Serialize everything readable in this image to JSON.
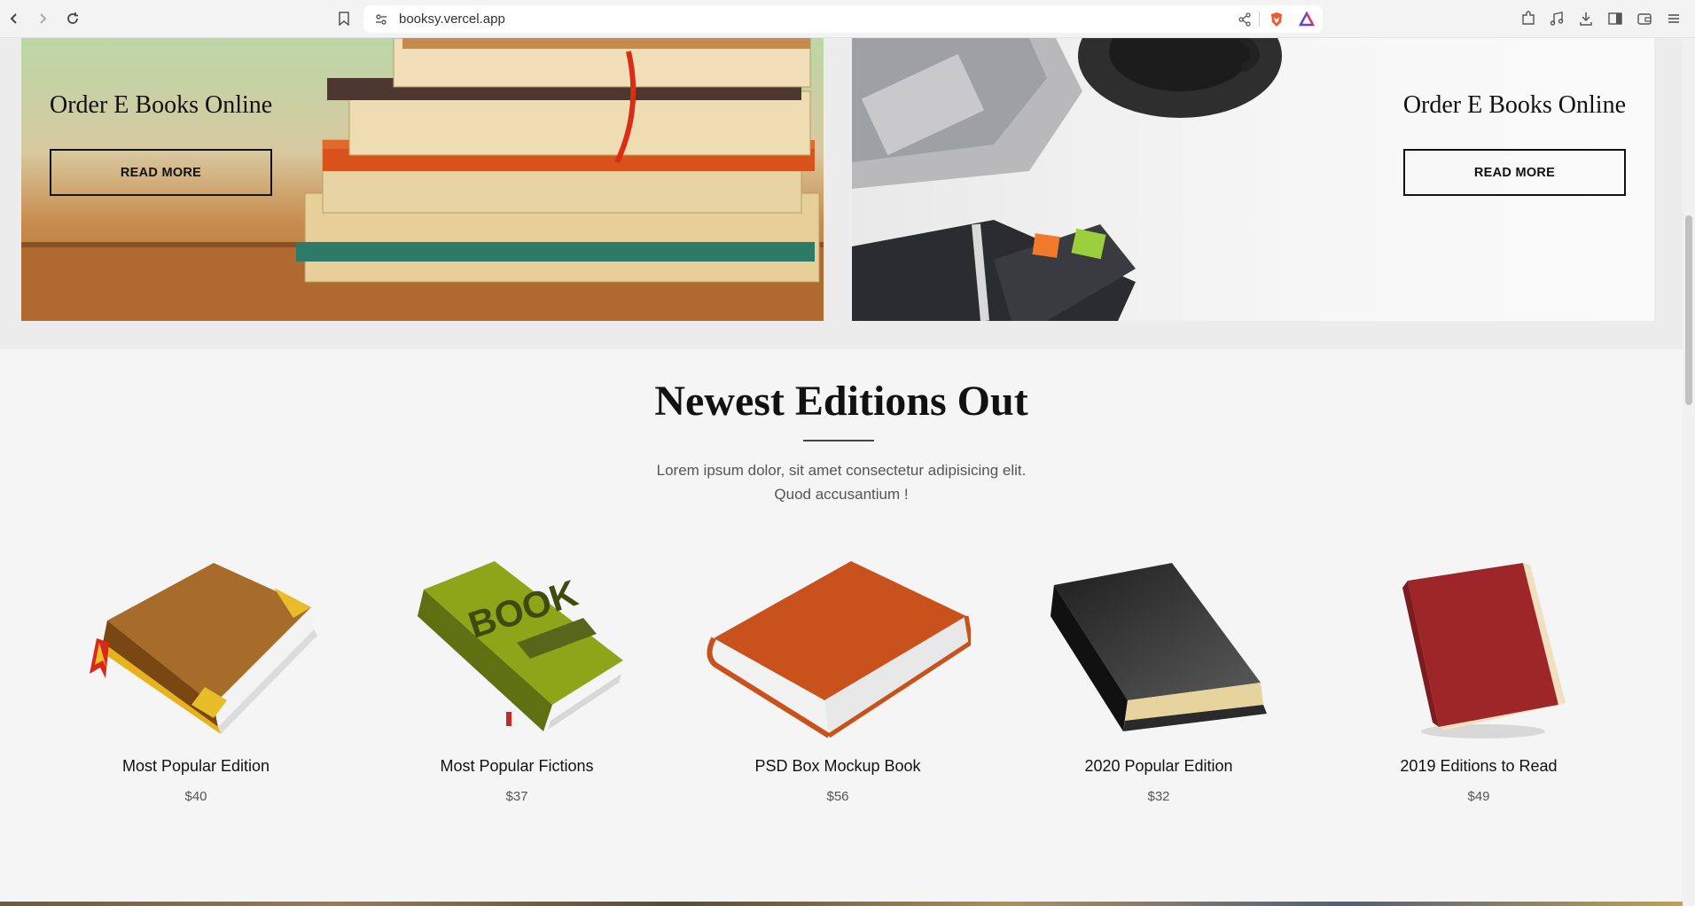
{
  "browser": {
    "url": "booksy.vercel.app"
  },
  "banners": [
    {
      "title": "Order E Books Online",
      "button": "READ MORE"
    },
    {
      "title": "Order E Books Online",
      "button": "READ MORE"
    }
  ],
  "section": {
    "title": "Newest Editions Out",
    "subtitle_line1": "Lorem ipsum dolor, sit amet consectetur adipisicing elit.",
    "subtitle_line2": "Quod accusantium !"
  },
  "products": [
    {
      "name": "Most Popular Edition",
      "price": "$40",
      "icon": "brown-book-icon"
    },
    {
      "name": "Most Popular Fictions",
      "price": "$37",
      "icon": "green-book-icon"
    },
    {
      "name": "PSD Box Mockup Book",
      "price": "$56",
      "icon": "orange-book-icon"
    },
    {
      "name": "2020 Popular Edition",
      "price": "$32",
      "icon": "black-book-icon"
    },
    {
      "name": "2019 Editions to Read",
      "price": "$49",
      "icon": "red-book-icon"
    }
  ],
  "book_label": "BOOK"
}
